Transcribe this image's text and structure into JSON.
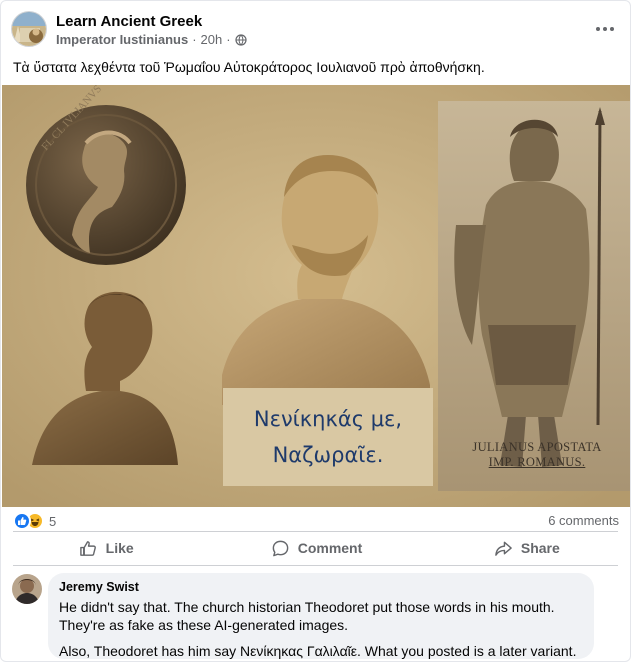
{
  "post": {
    "group_name": "Learn Ancient Greek",
    "author": "Imperator Iustinianus",
    "time": "20h",
    "caption": "Τὰ ὕστατα λεχθέντα τοῦ Ῥωμαΐου Αὐτοκράτορος Ιουλιανοῦ πρὸ ἀποθνήσκη."
  },
  "image": {
    "quote_line1": "Νενίκηκάς με,",
    "quote_line2": "Ναζωραῖε.",
    "statue_label_line1": "JULIANUS  APOSTATA",
    "statue_label_line2": "IMP. ROMANUS.",
    "coin_legend": "FL CL IVLIANVS"
  },
  "reactions": {
    "count": "5",
    "types": [
      "like-icon",
      "haha-icon"
    ],
    "comments_label": "6 comments"
  },
  "actions": {
    "like": "Like",
    "comment": "Comment",
    "share": "Share"
  },
  "comment": {
    "author": "Jeremy Swist",
    "line1": "He didn't say that. The church historian Theodoret put those words in his mouth.",
    "line2": "They're as fake as these AI-generated images.",
    "line3": "Also, Theodoret has him say Νενίκηκας Γαλιλαῖε. What you posted is a later variant."
  },
  "colors": {
    "facebook_blue": "#1877f2",
    "quote_blue": "#1e3a6b",
    "muted_text": "#65676b",
    "bubble_bg": "#f0f2f5"
  }
}
